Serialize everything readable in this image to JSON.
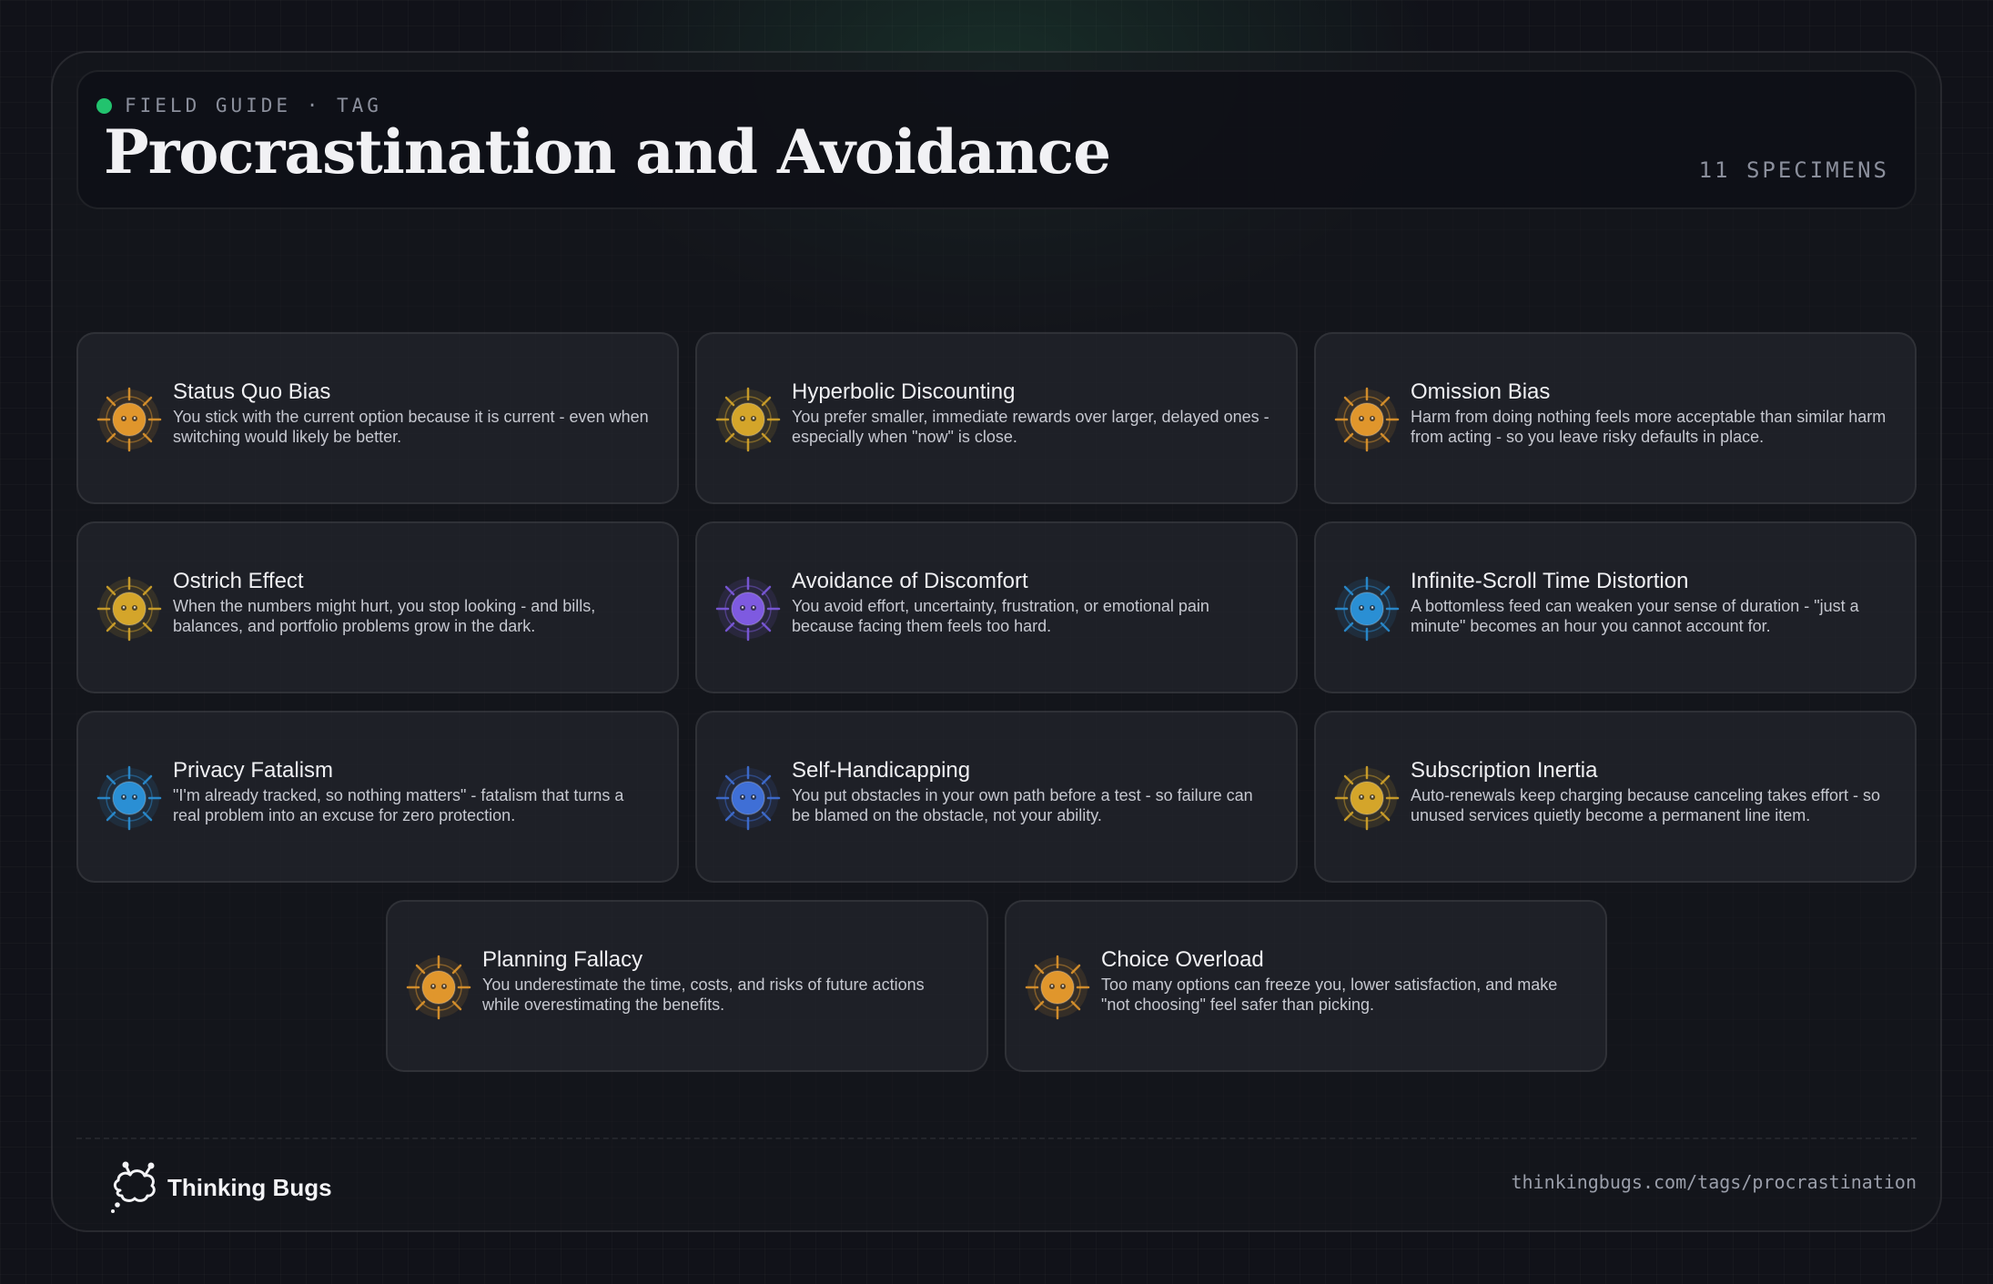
{
  "header": {
    "eyebrow": "FIELD GUIDE · TAG",
    "title": "Procrastination and Avoidance",
    "count": "11 SPECIMENS"
  },
  "cards": [
    {
      "name": "Status Quo Bias",
      "desc": "You stick with the current option because it is current - even when switching would likely be better.",
      "color": "#e0962c",
      "icon": "orange-bug-icon"
    },
    {
      "name": "Hyperbolic Discounting",
      "desc": "You prefer smaller, immediate rewards over larger, delayed ones - especially when \"now\" is close.",
      "color": "#d4a52a",
      "icon": "gold-bug-icon"
    },
    {
      "name": "Omission Bias",
      "desc": "Harm from doing nothing feels more acceptable than similar harm from acting - so you leave risky defaults in place.",
      "color": "#e0962c",
      "icon": "orange-bug-icon"
    },
    {
      "name": "Ostrich Effect",
      "desc": "When the numbers might hurt, you stop looking - and bills, balances, and portfolio problems grow in the dark.",
      "color": "#d4a52a",
      "icon": "gold-bug-icon"
    },
    {
      "name": "Avoidance of Discomfort",
      "desc": "You avoid effort, uncertainty, frustration, or emotional pain because facing them feels too hard.",
      "color": "#7e5ae0",
      "icon": "purple-bug-icon"
    },
    {
      "name": "Infinite-Scroll Time Distortion",
      "desc": "A bottomless feed can weaken your sense of duration - \"just a minute\" becomes an hour you cannot account for.",
      "color": "#2a8fd4",
      "icon": "blue-bug-icon"
    },
    {
      "name": "Privacy Fatalism",
      "desc": "\"I'm already tracked, so nothing matters\" - fatalism that turns a real problem into an excuse for zero protection.",
      "color": "#2a8fd4",
      "icon": "blue-bug-icon"
    },
    {
      "name": "Self-Handicapping",
      "desc": "You put obstacles in your own path before a test - so failure can be blamed on the obstacle, not your ability.",
      "color": "#3f6fd6",
      "icon": "blue-bug-icon"
    },
    {
      "name": "Subscription Inertia",
      "desc": "Auto-renewals keep charging because canceling takes effort - so unused services quietly become a permanent line item.",
      "color": "#d4a52a",
      "icon": "gold-bug-icon"
    },
    {
      "name": "Planning Fallacy",
      "desc": "You underestimate the time, costs, and risks of future actions while overestimating the benefits.",
      "color": "#e0962c",
      "icon": "orange-bug-icon"
    },
    {
      "name": "Choice Overload",
      "desc": "Too many options can freeze you, lower satisfaction, and make \"not choosing\" feel safer than picking.",
      "color": "#e0962c",
      "icon": "orange-bug-icon"
    }
  ],
  "footer": {
    "brand": "Thinking Bugs",
    "url": "thinkingbugs.com/tags/procrastination"
  }
}
